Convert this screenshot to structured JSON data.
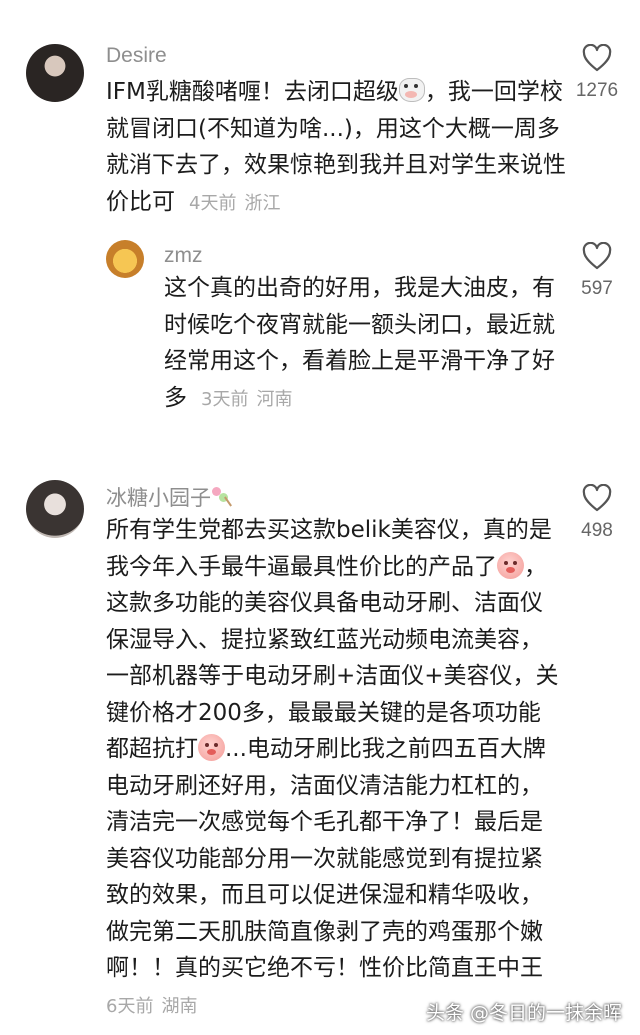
{
  "comments": [
    {
      "username": "Desire",
      "text_before": "IFM乳糖酸啫喱！去闭口超级",
      "emoji": "cow-face-emoji",
      "text_after": "，我一回学校就冒闭口(不知道为啥...)，用这个大概一周多就消下去了，效果惊艳到我并且对学生来说性价比可",
      "time": "4天前",
      "region": "浙江",
      "likes": "1276"
    },
    {
      "username": "zmz",
      "text": "这个真的出奇的好用，我是大油皮，有时候吃个夜宵就能一额头闭口，最近就经常用这个，看着脸上是平滑干净了好多",
      "time": "3天前",
      "region": "河南",
      "likes": "597"
    },
    {
      "username": "冰糖小园子",
      "username_emoji": "candy-skewer-emoji",
      "text_1": "所有学生党都去买这款belik美容仪，真的是我今年入手最牛逼最具性价比的产品了",
      "text_2": "，这款多功能的美容仪具备电动牙刷、洁面仪保湿导入、提拉紧致红蓝光动频电流美容，一部机器等于电动牙刷+洁面仪+美容仪，关键价格才200多，最最最关键的是各项功能都超抗打",
      "text_3": "...电动牙刷比我之前四五百大牌电动牙刷还好用，洁面仪清洁能力杠杠的，清洁完一次感觉每个毛孔都干净了！最后是美容仪功能部分用一次就能感觉到有提拉紧致的效果，而且可以促进保湿和精华吸收，做完第二天肌肤简直像剥了壳的鸡蛋那个嫩啊！！真的买它绝不亏！性价比简直王中王",
      "inline_emoji": "pink-pig-emoji",
      "time": "6天前",
      "region": "湖南",
      "likes": "498"
    }
  ],
  "watermark": "头条 @冬日的一抹余晖"
}
